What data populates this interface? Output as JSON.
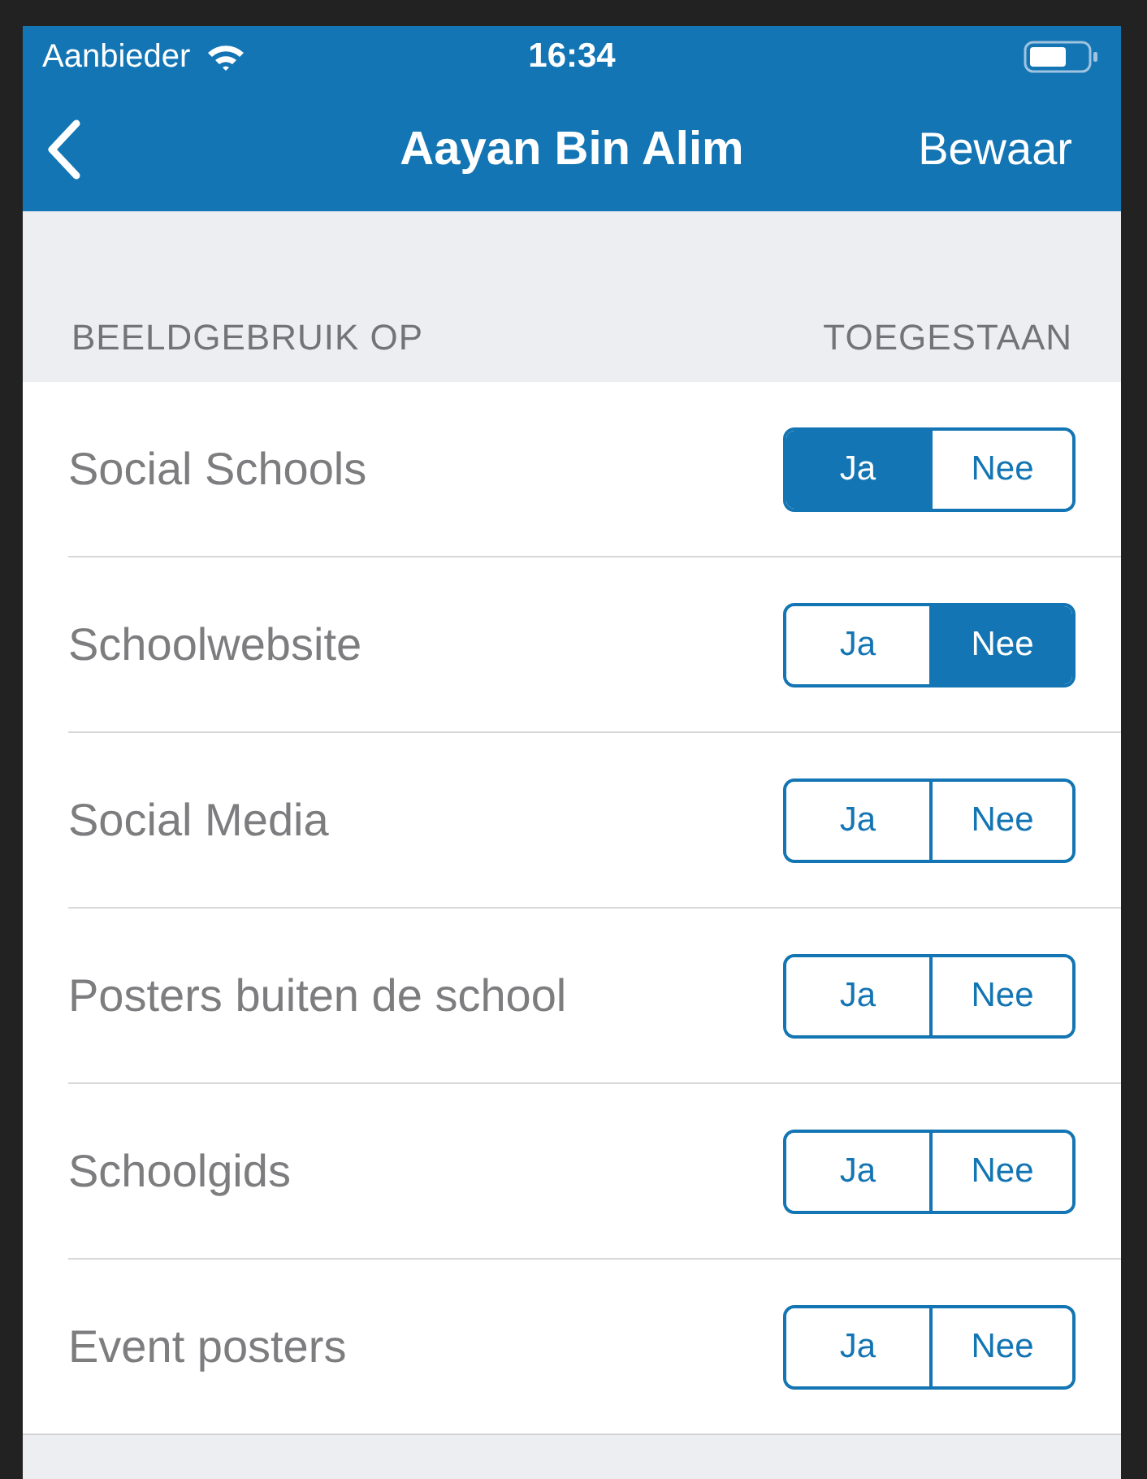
{
  "status_bar": {
    "carrier": "Aanbieder",
    "time": "16:34"
  },
  "nav_bar": {
    "title": "Aayan Bin Alim",
    "action": "Bewaar"
  },
  "section": {
    "title": "BEELDGEBRUIK OP",
    "column": "TOEGESTAAN"
  },
  "rows": [
    {
      "label": "Social Schools",
      "options": [
        {
          "label": "Ja",
          "selected": true
        },
        {
          "label": "Nee",
          "selected": false
        }
      ]
    },
    {
      "label": "Schoolwebsite",
      "options": [
        {
          "label": "Ja",
          "selected": false
        },
        {
          "label": "Nee",
          "selected": true
        }
      ]
    },
    {
      "label": "Social Media",
      "options": [
        {
          "label": "Ja",
          "selected": false
        },
        {
          "label": "Nee",
          "selected": false
        }
      ]
    },
    {
      "label": "Posters buiten de school",
      "options": [
        {
          "label": "Ja",
          "selected": false
        },
        {
          "label": "Nee",
          "selected": false
        }
      ]
    },
    {
      "label": "Schoolgids",
      "options": [
        {
          "label": "Ja",
          "selected": false
        },
        {
          "label": "Nee",
          "selected": false
        }
      ]
    },
    {
      "label": "Event posters",
      "options": [
        {
          "label": "Ja",
          "selected": false
        },
        {
          "label": "Nee",
          "selected": false
        }
      ]
    }
  ]
}
